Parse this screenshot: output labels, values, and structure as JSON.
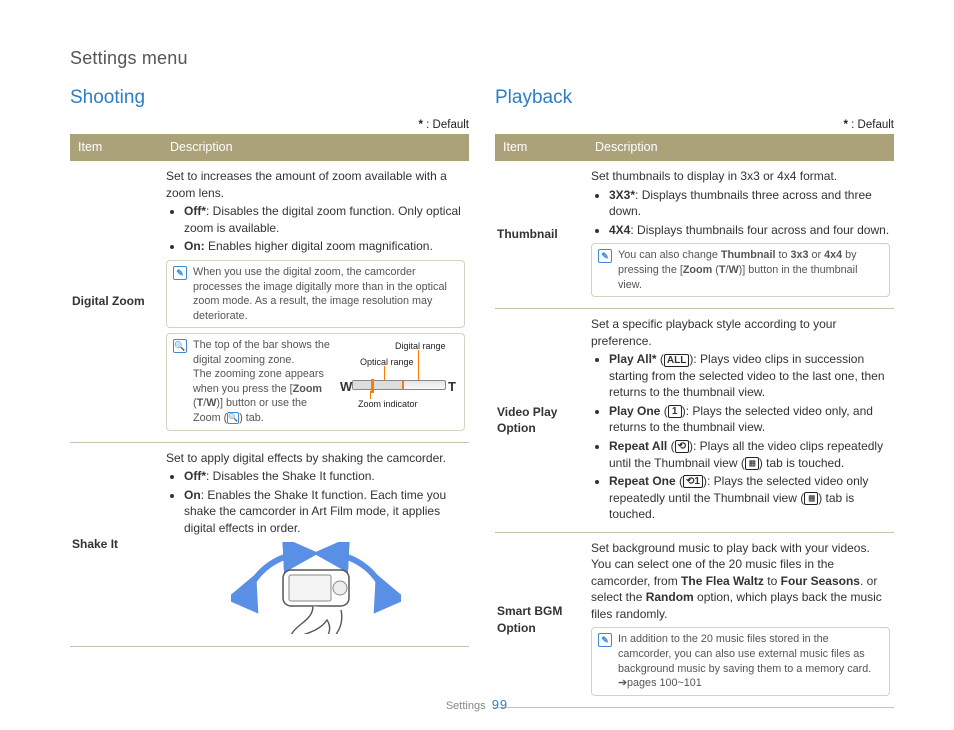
{
  "breadcrumb": "Settings menu",
  "footer_section": "Settings",
  "page_number": "99",
  "default_marker": "*",
  "default_label": " : Default",
  "tables": {
    "header_item": "Item",
    "header_desc": "Description"
  },
  "shooting": {
    "title": "Shooting",
    "rows": {
      "digital_zoom": {
        "name": "Digital Zoom",
        "lead": "Set to increases the amount of zoom available with a zoom lens.",
        "opt_off_label": "Off*",
        "opt_off_text": ": Disables the digital zoom function. Only optical zoom is available.",
        "opt_on_label": "On:",
        "opt_on_text": " Enables higher digital zoom magnification.",
        "note1": "When you use the digital zoom, the camcorder processes the image digitally more than in the optical zoom mode. As a result, the image resolution may deteriorate.",
        "note2_a": "The top of the bar shows the digital zooming zone.",
        "note2_b": "The zooming zone appears when you press the [",
        "note2_c": "Zoom",
        "note2_d": " (",
        "note2_e": "T",
        "note2_f": "/",
        "note2_g": "W",
        "note2_h": ")] button or use the Zoom (",
        "note2_i": ") tab.",
        "fig_digital": "Digital range",
        "fig_optical": "Optical range",
        "fig_zoomind": "Zoom indicator",
        "fig_W": "W",
        "fig_T": "T"
      },
      "shake_it": {
        "name": "Shake It",
        "lead": "Set to apply digital effects by shaking the camcorder.",
        "opt_off_label": "Off*",
        "opt_off_text": ": Disables the Shake It function.",
        "opt_on_label": "On",
        "opt_on_text": ": Enables the Shake It function. Each time you shake the camcorder in Art Film mode, it applies digital effects in order."
      }
    }
  },
  "playback": {
    "title": "Playback",
    "rows": {
      "thumbnail": {
        "name": "Thumbnail",
        "lead": "Set thumbnails to display in 3x3 or 4x4 format.",
        "opt1_label": "3X3*",
        "opt1_text": ": Displays thumbnails three across and three down.",
        "opt2_label": "4X4",
        "opt2_text": ": Displays thumbnails four across and four down.",
        "note_a": "You can also change ",
        "note_b": "Thumbnail",
        "note_c": " to ",
        "note_d": "3x3",
        "note_e": " or ",
        "note_f": "4x4",
        "note_g": " by pressing the [",
        "note_h": "Zoom",
        "note_i": " (",
        "note_j": "T",
        "note_k": "/",
        "note_l": "W",
        "note_m": ")] button in the thumbnail view."
      },
      "video_play": {
        "name": "Video Play Option",
        "lead": "Set a specific playback style according to your preference.",
        "opt1_label": "Play All*",
        "opt1_text": "): Plays video clips in succession starting from the selected video to the last one, then returns to the thumbnail view.",
        "opt2_label": "Play One",
        "opt2_text": "): Plays the selected video only, and returns to the thumbnail view.",
        "opt3_label": "Repeat All",
        "opt3_mid": "): Plays all the video clips repeatedly until the Thumbnail view (",
        "opt3_end": ") tab is touched.",
        "opt4_label": "Repeat One",
        "opt4_mid": "): Plays the selected video only repeatedly until the Thumbnail view (",
        "opt4_end": ") tab is touched.",
        "glyph_all": "ALL",
        "glyph_one": "1",
        "glyph_rall": "⟲",
        "glyph_rone": "⟲1",
        "glyph_thumb": "▦"
      },
      "smart_bgm": {
        "name": "Smart BGM Option",
        "text_a": "Set background music to play back with your videos. You can select one of the 20 music files in the camcorder, from ",
        "text_b": "The Flea Waltz",
        "text_c": " to ",
        "text_d": "Four Seasons",
        "text_e": ". or select the ",
        "text_f": "Random",
        "text_g": " option, which plays back the music files randomly.",
        "note": "In addition to the 20 music files stored in the camcorder, you can also use external music files as background music by saving them to a memory card. ➔pages 100~101"
      }
    }
  }
}
